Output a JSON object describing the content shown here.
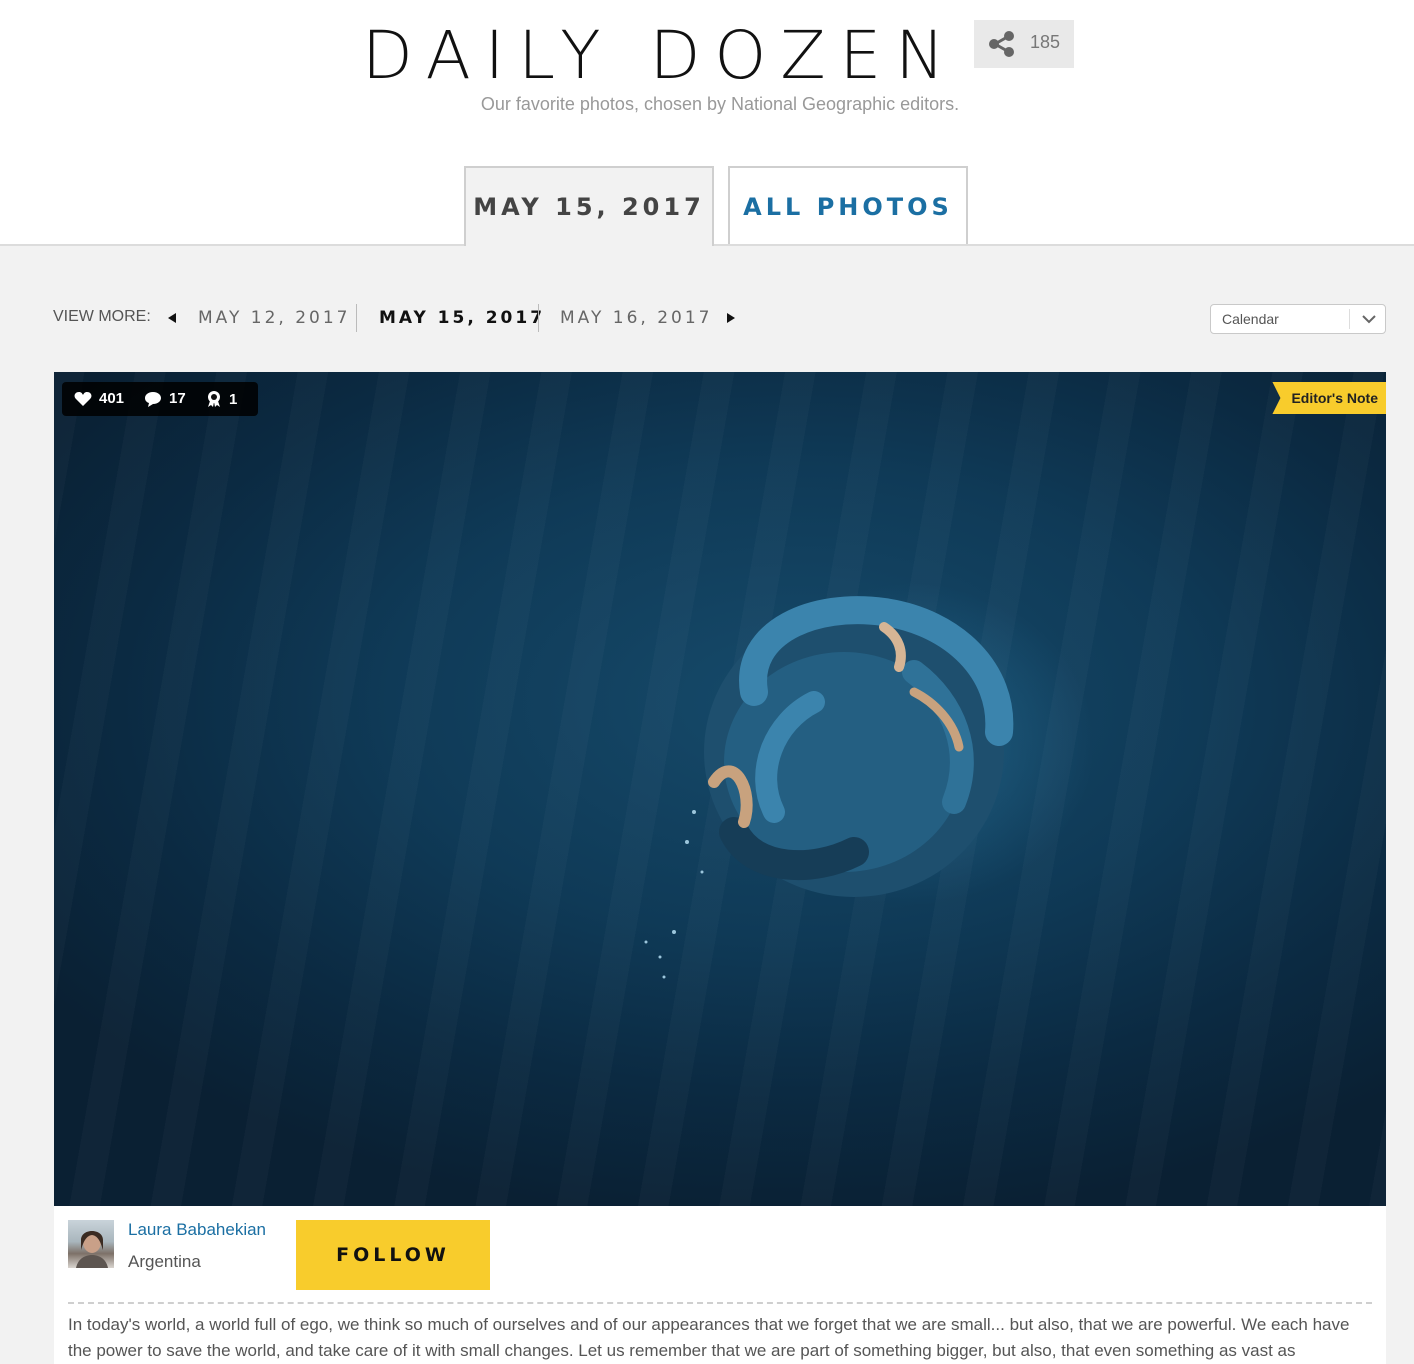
{
  "header": {
    "title": "DAILY DOZEN",
    "subtitle": "Our favorite photos, chosen by National Geographic editors.",
    "share_count": "185",
    "share_icon": "share-icon"
  },
  "tabs": [
    {
      "label": "MAY 15, 2017",
      "active": true
    },
    {
      "label": "ALL PHOTOS",
      "active": false
    }
  ],
  "view_more": {
    "label": "VIEW MORE:",
    "dates": [
      "MAY 12, 2017",
      "MAY 15, 2017",
      "MAY 16, 2017"
    ],
    "current_index": 1
  },
  "calendar": {
    "selected": "Calendar"
  },
  "photo": {
    "likes": "401",
    "comments": "17",
    "awards": "1",
    "badge": "Editor's Note"
  },
  "author": {
    "name": "Laura Babahekian",
    "country": "Argentina",
    "follow_label": "FOLLOW"
  },
  "caption": "In today's world, a world full of ego, we think so much of ourselves and of our appearances that we forget that we are small... but also, that we are powerful. We each have the power to save the world, and take care of it with small changes. Let us remember that we are part of something bigger, but also, that even something as vast as",
  "colors": {
    "accent_blue": "#1b6fa3",
    "accent_yellow": "#f8cc2c",
    "background_gray": "#f2f2f2"
  }
}
